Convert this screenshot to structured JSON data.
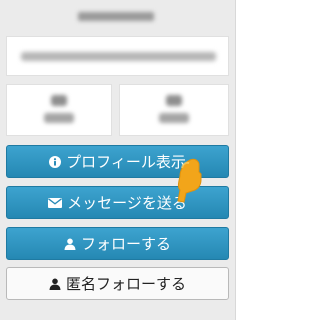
{
  "profile_card": {
    "buttons": {
      "profile_label": "プロフィール表示",
      "message_label": "メッセージを送る",
      "follow_label": "フォローする",
      "anonymous_follow_label": "匿名フォローする"
    },
    "icons": {
      "profile": "info-icon",
      "message": "envelope-icon",
      "follow": "user-icon",
      "anonymous_follow": "user-icon",
      "pointer": "hand-pointer-icon"
    },
    "colors": {
      "primary_button": "#2f94c0",
      "secondary_button": "#fafafa",
      "panel_background": "#ebebeb",
      "pointer": "#f2a51a"
    }
  }
}
